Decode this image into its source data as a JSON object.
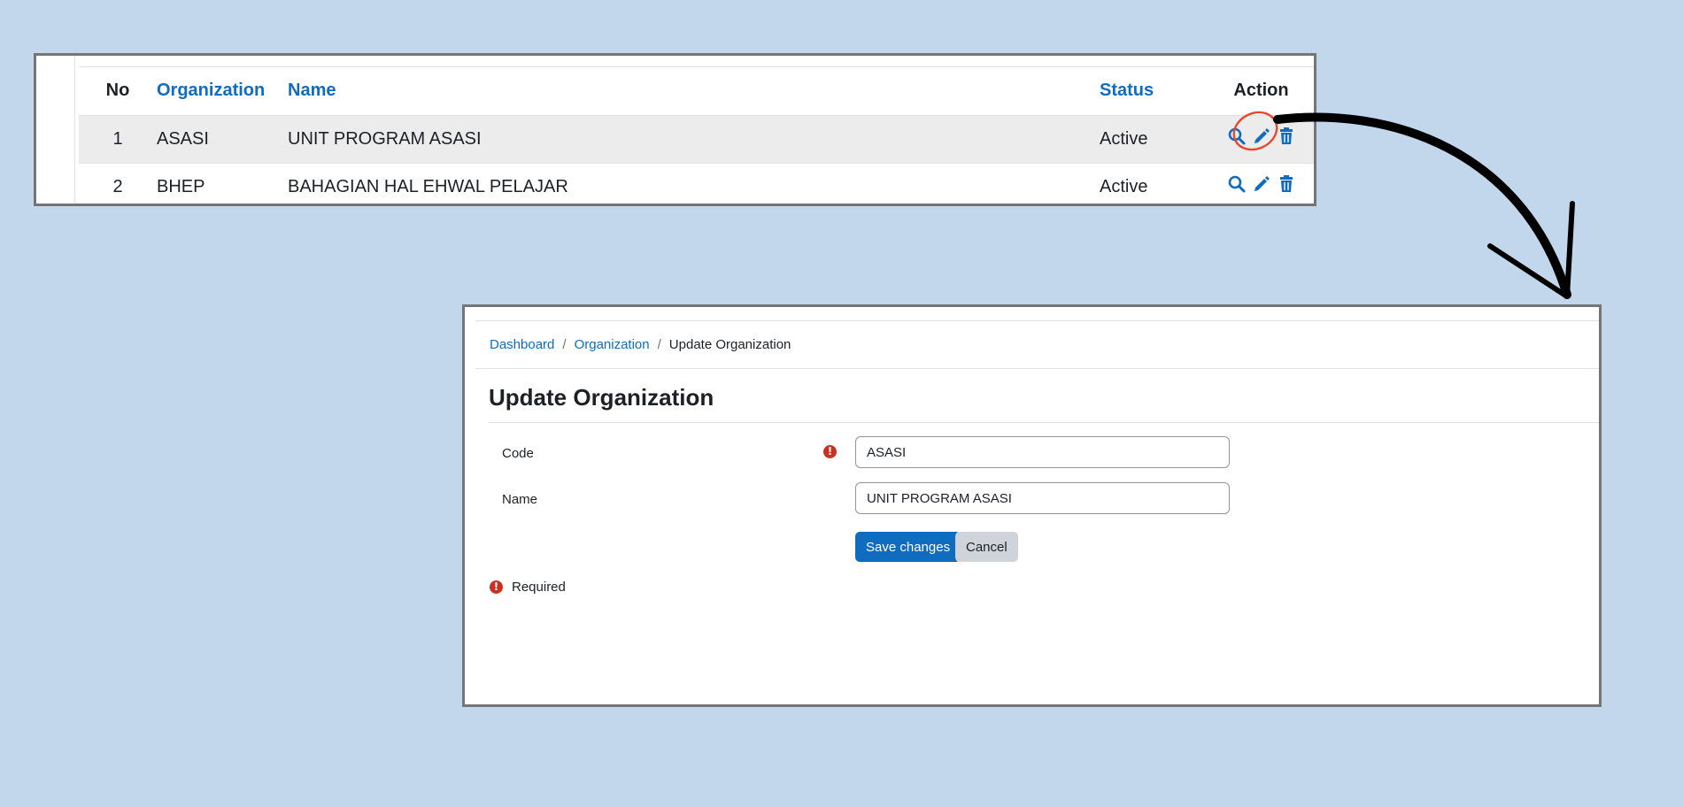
{
  "table": {
    "headers": {
      "no": "No",
      "organization": "Organization",
      "name": "Name",
      "status": "Status",
      "action": "Action"
    },
    "rows": [
      {
        "no": "1",
        "organization": "ASASI",
        "name": "UNIT PROGRAM ASASI",
        "status": "Active"
      },
      {
        "no": "2",
        "organization": "BHEP",
        "name": "BAHAGIAN HAL EHWAL PELAJAR",
        "status": "Active"
      }
    ],
    "action_icons": [
      "search-icon",
      "pencil-icon",
      "trash-icon"
    ]
  },
  "breadcrumb": {
    "dashboard": "Dashboard",
    "organization": "Organization",
    "current": "Update Organization",
    "separator": "/"
  },
  "form": {
    "title": "Update Organization",
    "code_label": "Code",
    "code_value": "ASASI",
    "name_label": "Name",
    "name_value": "UNIT PROGRAM ASASI",
    "save_label": "Save changes",
    "cancel_label": "Cancel",
    "required_label": "Required",
    "required_icon": "!"
  },
  "colors": {
    "background": "#c2d7ec",
    "link": "#0f6cbf",
    "primary_button": "#0f6cbf",
    "required": "#ca3120",
    "highlight_circle": "#e8482c",
    "arrow": "#000000"
  }
}
